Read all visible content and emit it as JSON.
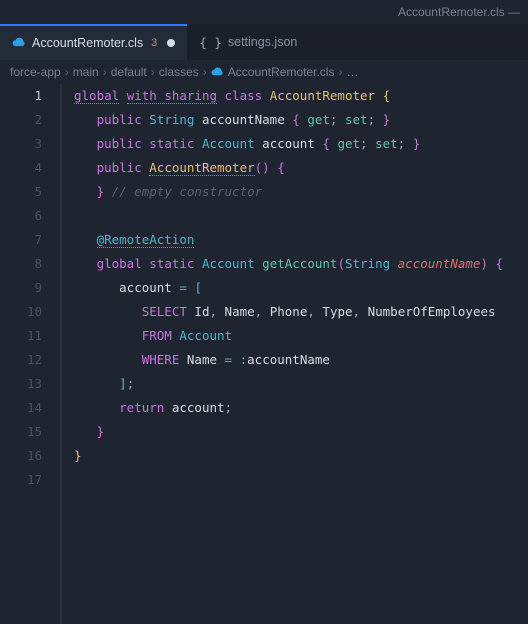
{
  "titlebar": {
    "filename": "AccountRemoter.cls —"
  },
  "tabs": [
    {
      "icon": "cloud",
      "label": "AccountRemoter.cls",
      "badge": "3",
      "dirty": true,
      "active": true
    },
    {
      "icon": "braces",
      "label": "settings.json",
      "badge": "",
      "dirty": false,
      "active": false
    }
  ],
  "breadcrumbs": {
    "parts": [
      "force-app",
      "main",
      "default",
      "classes"
    ],
    "file": "AccountRemoter.cls",
    "tail": "…"
  },
  "code": {
    "lines": [
      {
        "n": 1,
        "indent": 0,
        "tokens": [
          [
            "mod",
            "global",
            true
          ],
          [
            "sp",
            " "
          ],
          [
            "mod",
            "with sharing",
            true
          ],
          [
            "sp",
            " "
          ],
          [
            "kw",
            "class"
          ],
          [
            "sp",
            " "
          ],
          [
            "class",
            "AccountRemoter"
          ],
          [
            "sp",
            " "
          ],
          [
            "brace",
            "{"
          ]
        ]
      },
      {
        "n": 2,
        "indent": 1,
        "tokens": [
          [
            "mod",
            "public"
          ],
          [
            "sp",
            " "
          ],
          [
            "type",
            "String"
          ],
          [
            "sp",
            " "
          ],
          [
            "ident",
            "accountName"
          ],
          [
            "sp",
            " "
          ],
          [
            "brace2",
            "{"
          ],
          [
            "sp",
            " "
          ],
          [
            "func",
            "get"
          ],
          [
            "pun",
            ";"
          ],
          [
            "sp",
            " "
          ],
          [
            "func",
            "set"
          ],
          [
            "pun",
            ";"
          ],
          [
            "sp",
            " "
          ],
          [
            "brace2",
            "}"
          ]
        ]
      },
      {
        "n": 3,
        "indent": 1,
        "tokens": [
          [
            "mod",
            "public"
          ],
          [
            "sp",
            " "
          ],
          [
            "mod",
            "static"
          ],
          [
            "sp",
            " "
          ],
          [
            "type",
            "Account"
          ],
          [
            "sp",
            " "
          ],
          [
            "ident",
            "account"
          ],
          [
            "sp",
            " "
          ],
          [
            "brace2",
            "{"
          ],
          [
            "sp",
            " "
          ],
          [
            "func",
            "get"
          ],
          [
            "pun",
            ";"
          ],
          [
            "sp",
            " "
          ],
          [
            "func",
            "set"
          ],
          [
            "pun",
            ";"
          ],
          [
            "sp",
            " "
          ],
          [
            "brace2",
            "}"
          ]
        ]
      },
      {
        "n": 4,
        "indent": 1,
        "tokens": [
          [
            "mod",
            "public"
          ],
          [
            "sp",
            " "
          ],
          [
            "class",
            "AccountRemoter",
            true
          ],
          [
            "brace2",
            "("
          ],
          [
            "brace2",
            ")"
          ],
          [
            "sp",
            " "
          ],
          [
            "brace2",
            "{"
          ]
        ]
      },
      {
        "n": 5,
        "indent": 1,
        "tokens": [
          [
            "brace2",
            "}"
          ],
          [
            "sp",
            " "
          ],
          [
            "cmt",
            "// empty constructor"
          ]
        ]
      },
      {
        "n": 6,
        "indent": 0,
        "tokens": []
      },
      {
        "n": 7,
        "indent": 1,
        "tokens": [
          [
            "ann",
            "@RemoteAction",
            true
          ]
        ]
      },
      {
        "n": 8,
        "indent": 1,
        "tokens": [
          [
            "mod",
            "global"
          ],
          [
            "sp",
            " "
          ],
          [
            "mod",
            "static"
          ],
          [
            "sp",
            " "
          ],
          [
            "type",
            "Account"
          ],
          [
            "sp",
            " "
          ],
          [
            "func",
            "getAccount"
          ],
          [
            "brace2",
            "("
          ],
          [
            "type",
            "String"
          ],
          [
            "sp",
            " "
          ],
          [
            "param",
            "accountName"
          ],
          [
            "brace2",
            ")"
          ],
          [
            "sp",
            " "
          ],
          [
            "brace2",
            "{"
          ]
        ]
      },
      {
        "n": 9,
        "indent": 2,
        "tokens": [
          [
            "ident",
            "account"
          ],
          [
            "sp",
            " "
          ],
          [
            "op",
            "="
          ],
          [
            "sp",
            " "
          ],
          [
            "brace3",
            "["
          ]
        ]
      },
      {
        "n": 10,
        "indent": 3,
        "tokens": [
          [
            "sql",
            "SELECT"
          ],
          [
            "sp",
            " "
          ],
          [
            "ident",
            "Id"
          ],
          [
            "pun",
            ","
          ],
          [
            "sp",
            " "
          ],
          [
            "ident",
            "Name"
          ],
          [
            "pun",
            ","
          ],
          [
            "sp",
            " "
          ],
          [
            "ident",
            "Phone"
          ],
          [
            "pun",
            ","
          ],
          [
            "sp",
            " "
          ],
          [
            "ident",
            "Type"
          ],
          [
            "pun",
            ","
          ],
          [
            "sp",
            " "
          ],
          [
            "ident",
            "NumberOfEmployees"
          ]
        ]
      },
      {
        "n": 11,
        "indent": 3,
        "tokens": [
          [
            "sql",
            "FROM"
          ],
          [
            "sp",
            " "
          ],
          [
            "type",
            "Account"
          ]
        ]
      },
      {
        "n": 12,
        "indent": 3,
        "tokens": [
          [
            "sql",
            "WHERE"
          ],
          [
            "sp",
            " "
          ],
          [
            "ident",
            "Name"
          ],
          [
            "sp",
            " "
          ],
          [
            "op",
            "="
          ],
          [
            "sp",
            " "
          ],
          [
            "op",
            ":"
          ],
          [
            "ident",
            "accountName"
          ]
        ]
      },
      {
        "n": 13,
        "indent": 2,
        "tokens": [
          [
            "brace3",
            "]"
          ],
          [
            "pun",
            ";"
          ]
        ]
      },
      {
        "n": 14,
        "indent": 2,
        "tokens": [
          [
            "kw",
            "return"
          ],
          [
            "sp",
            " "
          ],
          [
            "ident",
            "account"
          ],
          [
            "pun",
            ";"
          ]
        ]
      },
      {
        "n": 15,
        "indent": 1,
        "tokens": [
          [
            "brace2",
            "}"
          ]
        ]
      },
      {
        "n": 16,
        "indent": 0,
        "tokens": [
          [
            "brace",
            "}"
          ]
        ]
      },
      {
        "n": 17,
        "indent": 0,
        "tokens": []
      }
    ]
  }
}
